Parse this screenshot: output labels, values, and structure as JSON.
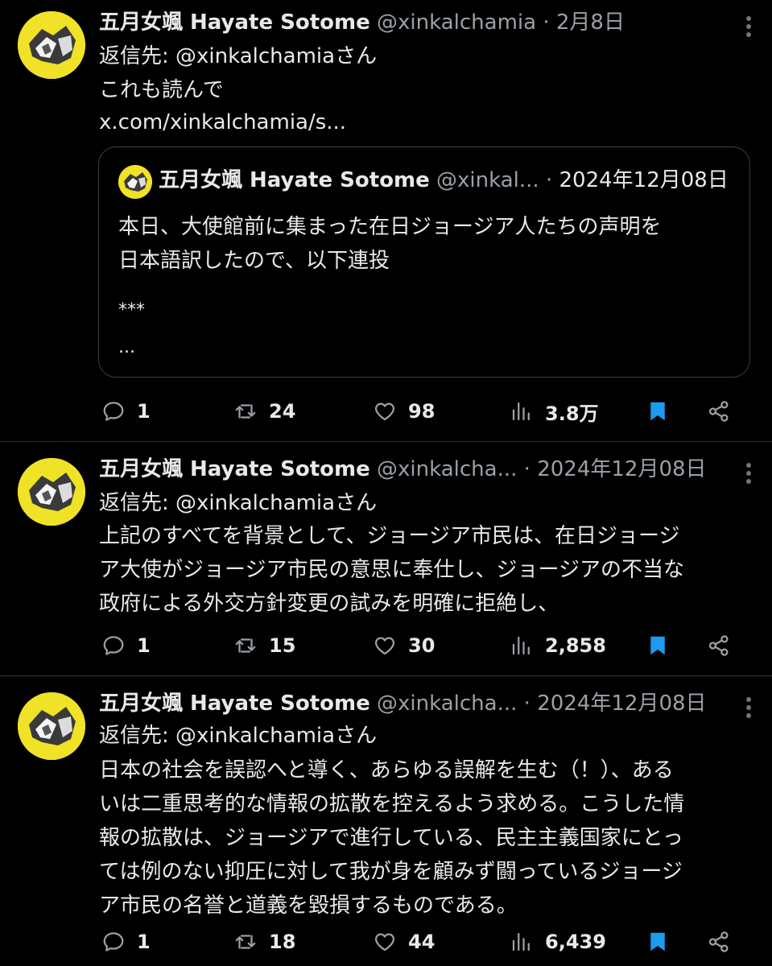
{
  "colors": {
    "background": "#000000",
    "text": "#e7e9ea",
    "muted": "#9aa0a6",
    "bookmark": "#1d9bf0",
    "avatar_bg": "#f0e227"
  },
  "icons": {
    "reply": "reply-icon",
    "retweet": "retweet-icon",
    "like": "heart-icon",
    "views": "views-icon",
    "bookmark": "bookmark-icon",
    "share": "share-icon",
    "more": "more-icon"
  },
  "tweets": [
    {
      "name": "五月女颯 Hayate Sotome",
      "handle": "@xinkalchamia",
      "sep": "·",
      "date": "2月8日",
      "reply_prefix": "返信先: ",
      "reply_handle": "@xinkalchamia",
      "reply_suffix": "さん",
      "body": "これも読んで\nx.com/xinkalchamia/s...",
      "quote": {
        "name": "五月女颯 Hayate Sotome",
        "handle": "@xinkal...",
        "sep": "·",
        "date": "2024年12月08日",
        "body": "本日、大使館前に集まった在日ジョージア人たちの声明を\n日本語訳したので、以下連投",
        "stars": "***",
        "ellipsis": "..."
      },
      "replies": "1",
      "retweets": "24",
      "likes": "98",
      "views": "3.8万",
      "bookmarked": true
    },
    {
      "name": "五月女颯 Hayate Sotome",
      "handle": "@xinkalcha...",
      "sep": "·",
      "date": "2024年12月08日",
      "reply_prefix": "返信先: ",
      "reply_handle": "@xinkalchamia",
      "reply_suffix": "さん",
      "body": "上記のすべてを背景として、ジョージア市民は、在日ジョージ\nア大使がジョージア市民の意思に奉仕し、ジョージアの不当な\n政府による外交方針変更の試みを明確に拒絶し、",
      "replies": "1",
      "retweets": "15",
      "likes": "30",
      "views": "2,858",
      "bookmarked": true
    },
    {
      "name": "五月女颯 Hayate Sotome",
      "handle": "@xinkalcha...",
      "sep": "·",
      "date": "2024年12月08日",
      "reply_prefix": "返信先: ",
      "reply_handle": "@xinkalchamia",
      "reply_suffix": "さん",
      "body": "日本の社会を誤認へと導く、あらゆる誤解を生む（！）、ある\nいは二重思考的な情報の拡散を控えるよう求める。こうした情\n報の拡散は、ジョージアで進行している、民主主義国家にとっ\nては例のない抑圧に対して我が身を顧みず闘っているジョージ\nア市民の名誉と道義を毀損するものである。",
      "replies": "1",
      "retweets": "18",
      "likes": "44",
      "views": "6,439",
      "bookmarked": true
    }
  ]
}
